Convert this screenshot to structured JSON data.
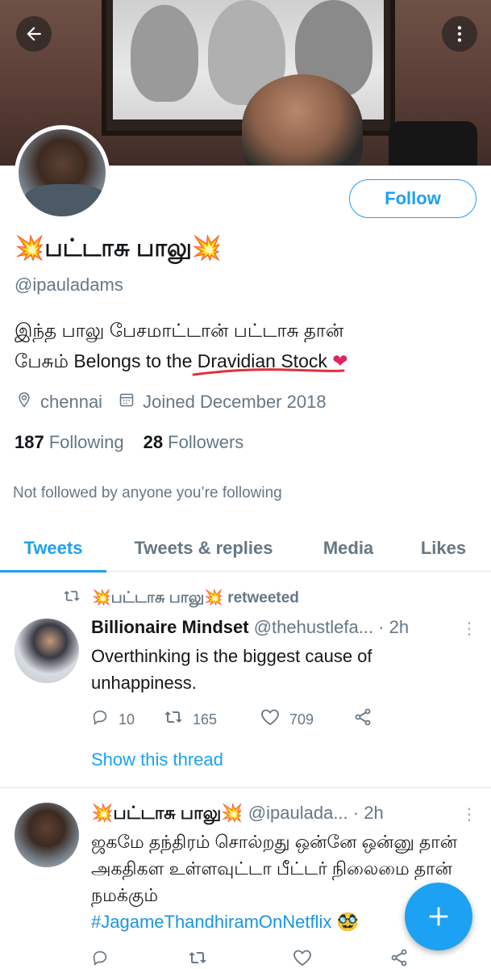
{
  "profile": {
    "display_name": "💥பட்டாசு பாலு💥",
    "handle": "@ipauladams",
    "bio_line1": "இந்த பாலு பேசமாட்டான் பட்டாசு தான்",
    "bio_line2": "பேசும் Belongs to the Dravidian Stock",
    "bio_emoji": "❤",
    "location": "chennai",
    "joined": "Joined December 2018",
    "following_count": "187",
    "following_label": "Following",
    "followers_count": "28",
    "followers_label": "Followers",
    "not_followed_text": "Not followed by anyone you’re following",
    "follow_button": "Follow"
  },
  "tabs": [
    {
      "label": "Tweets",
      "active": true
    },
    {
      "label": "Tweets & replies",
      "active": false
    },
    {
      "label": "Media",
      "active": false
    },
    {
      "label": "Likes",
      "active": false
    }
  ],
  "tweets": [
    {
      "retweet_by": "💥பட்டாசு பாலு💥 retweeted",
      "name": "Billionaire Mindset",
      "handle": "@thehustlefa...",
      "time": "· 2h",
      "text": "Overthinking is the biggest cause of unhappiness.",
      "replies": "10",
      "retweets": "165",
      "likes": "709",
      "show_thread": "Show this thread"
    },
    {
      "name": "💥பட்டாசு பாலு💥",
      "handle": "@ipaulada...",
      "time": "· 2h",
      "text": "ஜகமே தந்திரம் சொல்றது ஒன்னே ஒன்னு தான் அகதிகள உள்ளவுட்டா பீட்டர் நிலைமை தான் நமக்கும்",
      "hashtag": "#JagameThandhiramOnNetflix",
      "emoji": "🥸"
    }
  ],
  "icons": {
    "back": "arrow-left-icon",
    "more": "more-vertical-icon",
    "location": "location-pin-icon",
    "calendar": "calendar-icon",
    "retweet": "retweet-icon",
    "reply": "reply-icon",
    "like": "heart-icon",
    "share": "share-icon",
    "compose": "plus-icon"
  },
  "colors": {
    "accent": "#1da1f2",
    "muted": "#657786",
    "heart": "#e0245e",
    "underline": "#e0303a"
  }
}
